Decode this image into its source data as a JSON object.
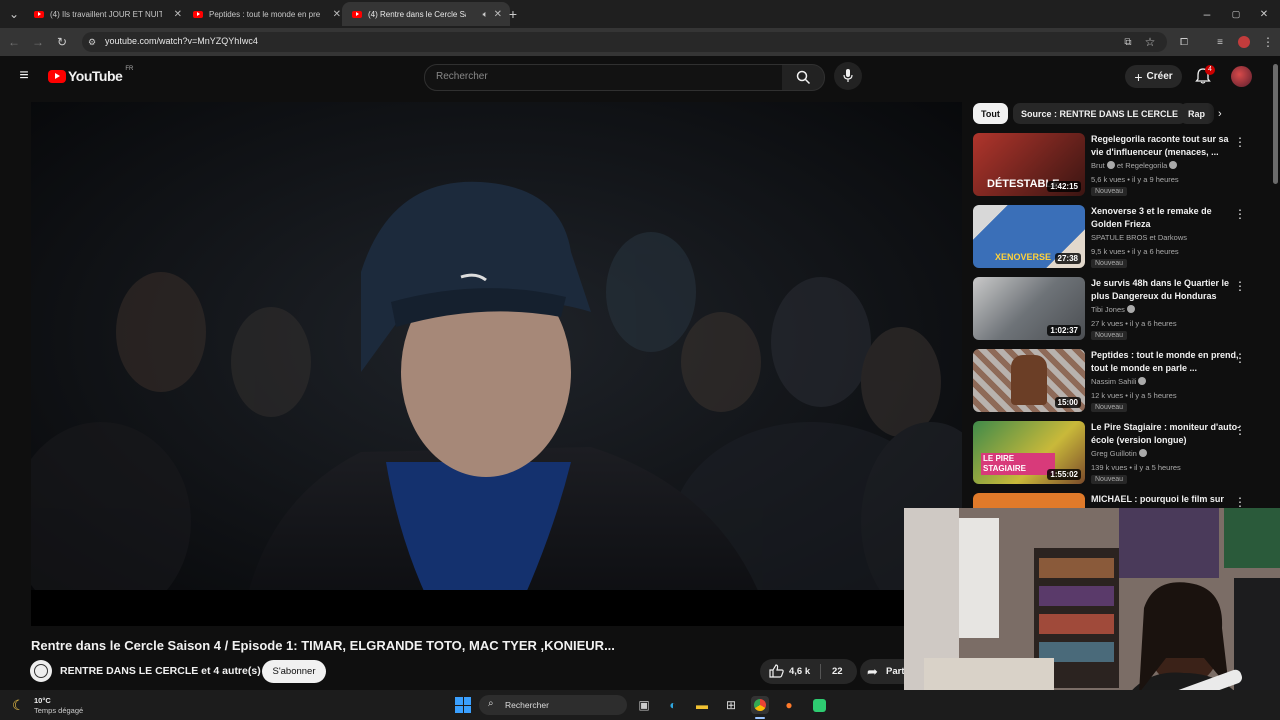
{
  "browser": {
    "tabs": [
      {
        "title": "(4) Ils travaillent JOUR ET NUIT",
        "active": false
      },
      {
        "title": "Peptides : tout le monde en pre",
        "active": false
      },
      {
        "title": "(4) Rentre dans le Cercle Sa",
        "active": true
      }
    ],
    "new_tab_icon": "plus-icon",
    "url": "youtube.com/watch?v=MnYZQYhIwc4"
  },
  "youtube": {
    "logo_text": "YouTube",
    "region": "FR",
    "search_placeholder": "Rechercher",
    "create_label": "Créer",
    "notification_count": "4"
  },
  "chips": [
    {
      "label": "Tout",
      "selected": true
    },
    {
      "label": "Source : RENTRE DANS LE CERCLE",
      "selected": false
    },
    {
      "label": "Rap",
      "selected": false
    }
  ],
  "video": {
    "title": "Rentre dans le Cercle Saison 4 / Episode 1: TIMAR, ELGRANDE TOTO, MAC TYER ,KONIEUR...",
    "channel": "RENTRE DANS LE CERCLE et 4 autre(s)",
    "subscribe_label": "S'abonner",
    "likes": "4,6 k",
    "comments": "22",
    "share_label": "Part"
  },
  "recommendations": [
    {
      "title": "Regelegorila raconte tout sur sa vie d'influenceur (menaces, ...",
      "channel": "Brut",
      "channel2": "et Regelegorila",
      "views": "5,6 k vues",
      "age": "il y a 9 heures",
      "badge": "Nouveau",
      "duration": "1:42:15",
      "thumb_text": "DÉTESTABLE",
      "thumb_color": "#b0352c"
    },
    {
      "title": "Xenoverse 3 et le remake de Golden Frieza",
      "channel": "SPATULE BROS et Darkows",
      "views": "9,5 k vues",
      "age": "il y a 6 heures",
      "badge": "Nouveau",
      "duration": "27:38",
      "thumb_text": "XENOVERSE",
      "thumb_color": "#3a6fb8"
    },
    {
      "title": "Je survis 48h dans le Quartier le plus Dangereux du Honduras",
      "channel": "Tibi Jones",
      "views": "27 k vues",
      "age": "il y a 6 heures",
      "badge": "Nouveau",
      "duration": "1:02:37",
      "thumb_text": "",
      "thumb_color": "#8a8f94"
    },
    {
      "title": "Peptides : tout le monde en prend, tout le monde en parle ...",
      "channel": "Nassim Sahili",
      "views": "12 k vues",
      "age": "il y a 5 heures",
      "badge": "Nouveau",
      "duration": "15:00",
      "thumb_text": "",
      "thumb_color": "#9a6f55"
    },
    {
      "title": "Le Pire Stagiaire : moniteur d'auto-école (version longue)",
      "channel": "Greg Guillotin",
      "views": "139 k vues",
      "age": "il y a 5 heures",
      "badge": "Nouveau",
      "duration": "1:55:02",
      "thumb_text": "LE PIRE STAGIAIRE",
      "thumb_color": "#3f8a4a"
    },
    {
      "title": "MICHAEL : pourquoi le film sur",
      "channel": "",
      "views": "",
      "age": "",
      "badge": "",
      "duration": "",
      "thumb_text": "",
      "thumb_color": "#e07a2a"
    }
  ],
  "taskbar": {
    "weather_temp": "10°C",
    "weather_desc": "Temps dégagé",
    "search_label": "Rechercher"
  },
  "colors": {
    "youtube_red": "#ff0000",
    "background": "#0f0f0f"
  }
}
